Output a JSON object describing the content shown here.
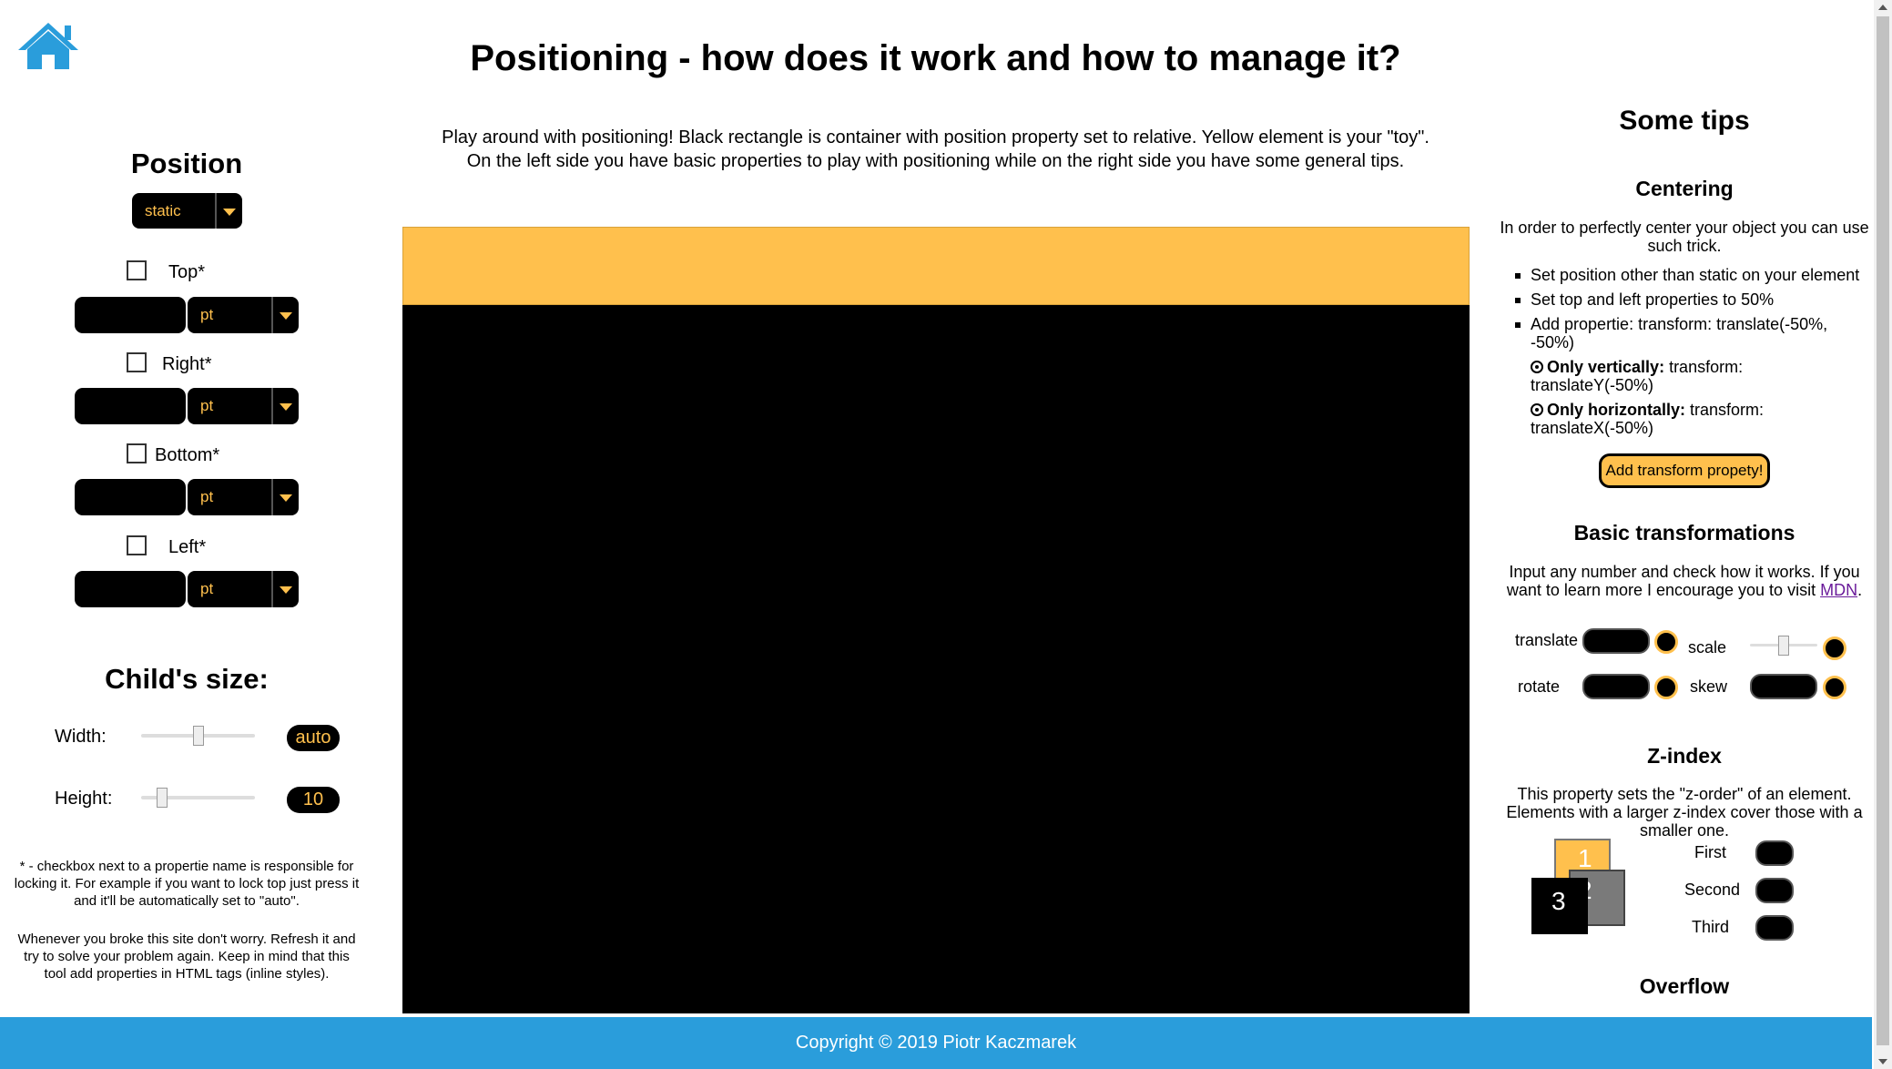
{
  "page": {
    "title": "Positioning - how does it work and how to manage it?",
    "intro_line1": "Play around with positioning! Black rectangle is container with position property set to relative. Yellow element is your \"toy\".",
    "intro_line2": "On the left side you have basic properties to play with positioning while on the right side you have some general tips."
  },
  "colors": {
    "accent": "#ffc04d",
    "brand_blue": "#2a9ddb",
    "home_icon": "#2a9ddb"
  },
  "icons": {
    "home": "home-icon"
  },
  "left": {
    "position_title": "Position",
    "position_select": "static",
    "props": [
      {
        "label": "Top*",
        "unit": "pt"
      },
      {
        "label": "Right*",
        "unit": "pt"
      },
      {
        "label": "Bottom*",
        "unit": "pt"
      },
      {
        "label": "Left*",
        "unit": "pt"
      }
    ],
    "size_title": "Child's size:",
    "width_label": "Width:",
    "width_value": "auto",
    "width_slider": 0.5,
    "height_label": "Height:",
    "height_value": "10",
    "height_slider": 0.15,
    "note1": "* - checkbox next to a propertie name is responsible for locking it. For example if you want to lock top just press it and it'll be automatically set to \"auto\".",
    "note2": "Whenever you broke this site don't worry. Refresh it and try to solve your problem again. Keep in mind that this tool add properties in HTML tags (inline styles)."
  },
  "right": {
    "tips_title": "Some tips",
    "centering_title": "Centering",
    "centering_intro": "In order to perfectly center your object you can use such trick.",
    "centering_items": [
      "Set position other than static on your element",
      "Set top and left properties to 50%",
      "Add propertie: transform: translate(-50%, -50%)"
    ],
    "only_vertically_bold": "Only vertically:",
    "only_vertically_rest": " transform: translateY(-50%)",
    "only_horizontally_bold": "Only horizontally:",
    "only_horizontally_rest": " transform: translateX(-50%)",
    "add_transform_button": "Add transform propety!",
    "basic_title": "Basic transformations",
    "basic_intro_a": "Input any number and check how it works. If you want to learn more I encourage you to visit ",
    "basic_intro_link": "MDN",
    "basic_intro_b": ".",
    "translate_label": "translate",
    "scale_label": "scale",
    "scale_slider": 0.5,
    "rotate_label": "rotate",
    "skew_label": "skew",
    "zindex_title": "Z-index",
    "zindex_intro": "This property sets the \"z-order\" of an element. Elements with a larger z-index cover those with a smaller one.",
    "zbox_1": "1",
    "zbox_2": "2",
    "zbox_3": "3",
    "first_label": "First",
    "second_label": "Second",
    "third_label": "Third",
    "overflow_title": "Overflow"
  },
  "footer": {
    "copyright": "Copyright © 2019 Piotr Kaczmarek"
  }
}
